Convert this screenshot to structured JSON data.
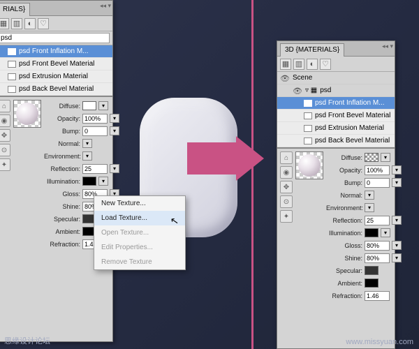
{
  "panelTitle": "3D {MATERIALS}",
  "partialTitle": "RIALS}",
  "filter": "psd",
  "scene": "Scene",
  "psdNode": "psd",
  "materials": [
    "psd Front Inflation M...",
    "psd Front Bevel Material",
    "psd Extrusion Material",
    "psd Back Bevel Material"
  ],
  "props": {
    "diffuse": "Diffuse:",
    "opacity": "Opacity:",
    "opacityVal": "100%",
    "bump": "Bump:",
    "bumpVal": "0",
    "normal": "Normal:",
    "environment": "Environment:",
    "reflection": "Reflection:",
    "reflectionVal": "25",
    "illumination": "Illumination:",
    "gloss": "Gloss:",
    "glossVal": "80%",
    "shine": "Shine:",
    "shineVal": "80%",
    "specular": "Specular:",
    "ambient": "Ambient:",
    "refraction": "Refraction:",
    "refractionVal": "1.46"
  },
  "ctx": {
    "new": "New Texture...",
    "load": "Load Texture...",
    "open": "Open Texture...",
    "edit": "Edit Properties...",
    "remove": "Remove Texture"
  },
  "wm1": "思缘设计论坛",
  "wm2": "www.missyuan.com"
}
